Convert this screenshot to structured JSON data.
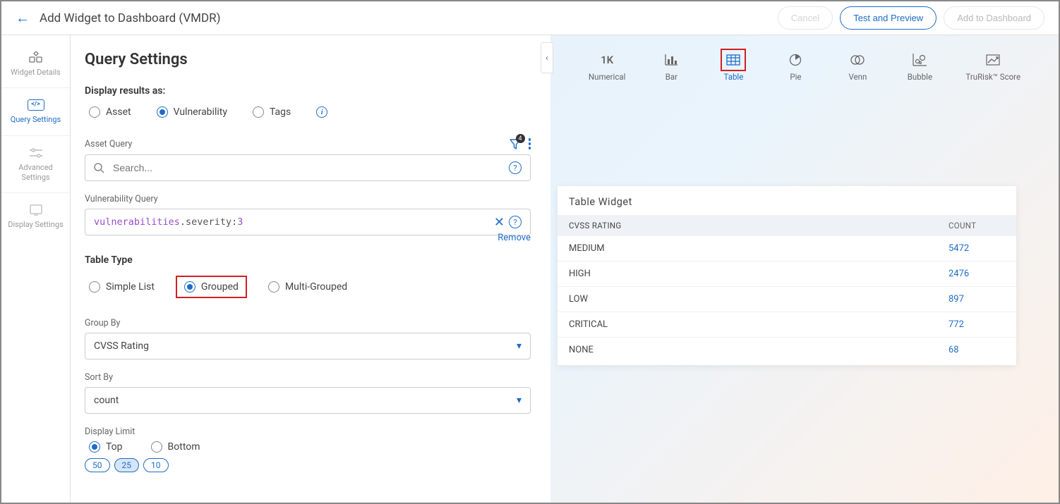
{
  "header": {
    "title": "Add Widget to Dashboard (VMDR)",
    "cancel": "Cancel",
    "test": "Test and Preview",
    "add": "Add to Dashboard"
  },
  "sidebar": {
    "details": "Widget Details",
    "query": "Query Settings",
    "advanced": "Advanced Settings",
    "display": "Display Settings"
  },
  "main": {
    "title": "Query Settings",
    "display_as_label": "Display results as:",
    "ra_asset": "Asset",
    "ra_vuln": "Vulnerability",
    "ra_tags": "Tags",
    "asset_query_label": "Asset Query",
    "filter_badge": "4",
    "search_placeholder": "Search...",
    "vuln_query_label": "Vulnerability Query",
    "vq_tok1": "vulnerabilities",
    "vq_tok2": ".severity:",
    "vq_tok3": "3",
    "remove": "Remove",
    "table_type_label": "Table Type",
    "tt_simple": "Simple List",
    "tt_grouped": "Grouped",
    "tt_multi": "Multi-Grouped",
    "group_by_label": "Group By",
    "group_by_value": "CVSS Rating",
    "sort_by_label": "Sort By",
    "sort_by_value": "count",
    "display_limit_label": "Display Limit",
    "dl_top": "Top",
    "dl_bottom": "Bottom",
    "pill_50": "50",
    "pill_25": "25",
    "pill_10": "10"
  },
  "preview": {
    "ct_numerical": "Numerical",
    "ct_num_val": "1K",
    "ct_bar": "Bar",
    "ct_table": "Table",
    "ct_pie": "Pie",
    "ct_venn": "Venn",
    "ct_bubble": "Bubble",
    "ct_trurisk": "TruRisk™ Score",
    "widget_title": "Table Widget",
    "col_rating": "CVSS RATING",
    "col_count": "COUNT",
    "rows": [
      {
        "rating": "MEDIUM",
        "count": "5472"
      },
      {
        "rating": "HIGH",
        "count": "2476"
      },
      {
        "rating": "LOW",
        "count": "897"
      },
      {
        "rating": "CRITICAL",
        "count": "772"
      },
      {
        "rating": "NONE",
        "count": "68"
      }
    ]
  },
  "chart_data": {
    "type": "table",
    "title": "Table Widget",
    "columns": [
      "CVSS RATING",
      "COUNT"
    ],
    "rows": [
      [
        "MEDIUM",
        5472
      ],
      [
        "HIGH",
        2476
      ],
      [
        "LOW",
        897
      ],
      [
        "CRITICAL",
        772
      ],
      [
        "NONE",
        68
      ]
    ]
  }
}
